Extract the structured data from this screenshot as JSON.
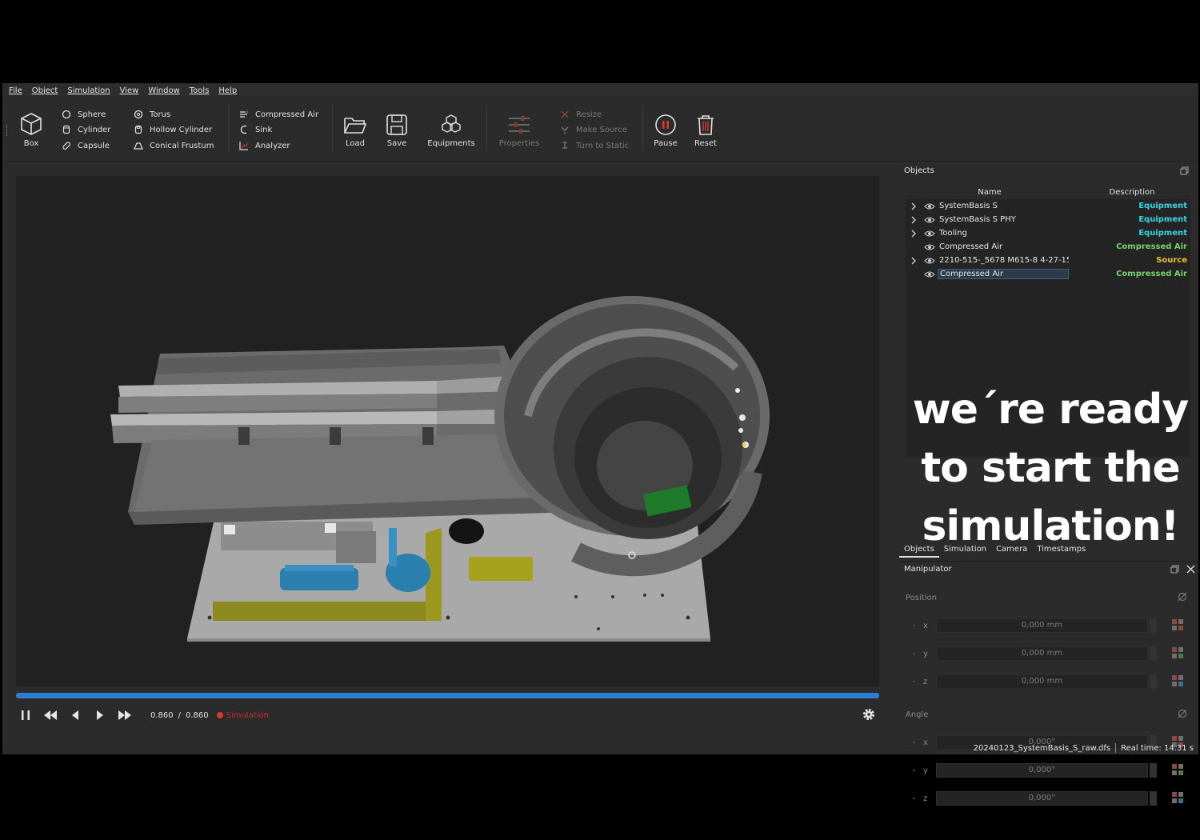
{
  "menu": [
    "File",
    "Object",
    "Simulation",
    "View",
    "Window",
    "Tools",
    "Help"
  ],
  "toolbar": {
    "box": "Box",
    "primitives_col1": [
      "Sphere",
      "Cylinder",
      "Capsule"
    ],
    "primitives_col2": [
      "Torus",
      "Hollow Cylinder",
      "Conical Frustum"
    ],
    "special": [
      "Compressed Air",
      "Sink",
      "Analyzer"
    ],
    "load": "Load",
    "save": "Save",
    "equipments": "Equipments",
    "properties": "Properties",
    "edit_actions": [
      "Resize",
      "Make Source",
      "Turn to Static"
    ],
    "pause": "Pause",
    "reset": "Reset"
  },
  "playback": {
    "current": "0.860",
    "separator": "/",
    "total": "0.860",
    "progress": 1.0,
    "status": "Simulation"
  },
  "objects_panel": {
    "title": "Objects",
    "col_name": "Name",
    "col_desc": "Description",
    "rows": [
      {
        "name": "SystemBasis S",
        "desc": "Equipment",
        "expandable": true,
        "kind": "equip"
      },
      {
        "name": "SystemBasis S PHY",
        "desc": "Equipment",
        "expandable": true,
        "kind": "equip"
      },
      {
        "name": "Tooling",
        "desc": "Equipment",
        "expandable": true,
        "kind": "equip"
      },
      {
        "name": "Compressed Air",
        "desc": "Compressed Air",
        "expandable": false,
        "kind": "air"
      },
      {
        "name": "2210-515-_5678 M615-8 4-27-15-...",
        "desc": "Source",
        "expandable": true,
        "kind": "src"
      },
      {
        "name": "Compressed Air",
        "desc": "Compressed Air",
        "expandable": false,
        "kind": "air",
        "selected": true
      }
    ]
  },
  "overlay_lines": [
    "we´re ready",
    "to start the",
    "simulation!"
  ],
  "panel_tabs": [
    "Objects",
    "Simulation",
    "Camera",
    "Timestamps"
  ],
  "manipulator": {
    "title": "Manipulator",
    "position_label": "Position",
    "angle_label": "Angle",
    "position": [
      {
        "axis": "x",
        "value": "0,000 mm"
      },
      {
        "axis": "y",
        "value": "0,000 mm"
      },
      {
        "axis": "z",
        "value": "0,000 mm"
      }
    ],
    "angle": [
      {
        "axis": "x",
        "value": "0,000°"
      },
      {
        "axis": "y",
        "value": "0,000°"
      },
      {
        "axis": "z",
        "value": "0,000°"
      }
    ]
  },
  "statusbar": {
    "file": "20240123_SystemBasis_S_raw.dfs",
    "realtime": "Real time: 14.31 s"
  },
  "colors": {
    "accent": "#2a7fd4",
    "equipment": "#2fd6e6",
    "compressed_air": "#72d66a",
    "source": "#e8c22e",
    "sim_red": "#d93a2f"
  }
}
